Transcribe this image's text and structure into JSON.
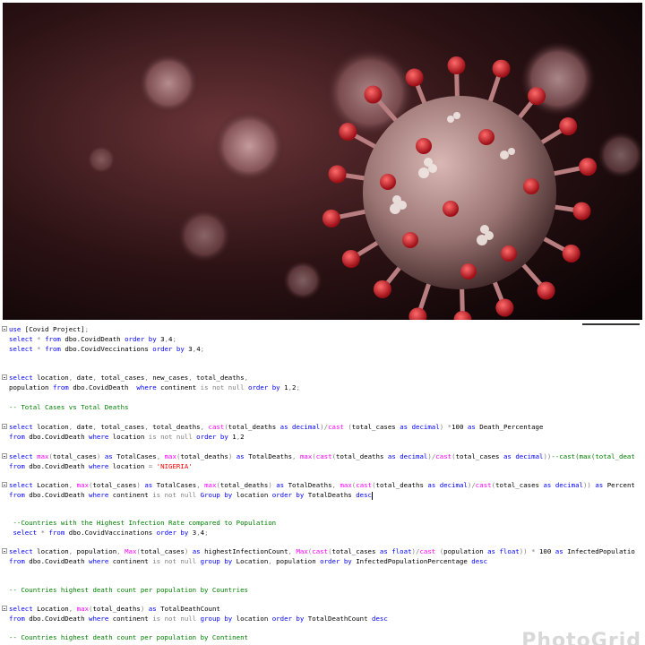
{
  "hero": {
    "description_icon": "virus-icon"
  },
  "editor": {
    "lines": [
      {
        "id": "l1",
        "fold": true,
        "parts": [
          [
            "kw",
            "use"
          ],
          [
            "id",
            " [Covid Project]"
          ],
          [
            "op",
            ";"
          ]
        ]
      },
      {
        "id": "l2",
        "fold": false,
        "parts": [
          [
            "kw",
            "select"
          ],
          [
            "op",
            " * "
          ],
          [
            "kw",
            "from"
          ],
          [
            "id",
            " dbo.CovidDeath "
          ],
          [
            "kw",
            "order by"
          ],
          [
            "id",
            " 3"
          ],
          [
            "op",
            ","
          ],
          [
            "id",
            "4"
          ],
          [
            "op",
            ";"
          ]
        ]
      },
      {
        "id": "l3",
        "fold": false,
        "parts": [
          [
            "kw",
            "select"
          ],
          [
            "op",
            " * "
          ],
          [
            "kw",
            "from"
          ],
          [
            "id",
            " dbo.CovidVeccinations "
          ],
          [
            "kw",
            "order by"
          ],
          [
            "id",
            " 3"
          ],
          [
            "op",
            ","
          ],
          [
            "id",
            "4"
          ],
          [
            "op",
            ";"
          ]
        ]
      },
      {
        "id": "l4",
        "fold": true,
        "parts": [
          [
            "kw",
            "select"
          ],
          [
            "id",
            " location"
          ],
          [
            "op",
            ","
          ],
          [
            "id",
            " date"
          ],
          [
            "op",
            ","
          ],
          [
            "id",
            " total_cases"
          ],
          [
            "op",
            ","
          ],
          [
            "id",
            " new_cases"
          ],
          [
            "op",
            ","
          ],
          [
            "id",
            " total_deaths"
          ],
          [
            "op",
            ","
          ]
        ]
      },
      {
        "id": "l5",
        "fold": false,
        "parts": [
          [
            "id",
            "population "
          ],
          [
            "kw",
            "from"
          ],
          [
            "id",
            " dbo.CovidDeath  "
          ],
          [
            "kw",
            "where"
          ],
          [
            "id",
            " continent "
          ],
          [
            "op",
            "is not null"
          ],
          [
            "id",
            " "
          ],
          [
            "kw",
            "order by"
          ],
          [
            "id",
            " 1"
          ],
          [
            "op",
            ","
          ],
          [
            "id",
            "2"
          ],
          [
            "op",
            ";"
          ]
        ]
      },
      {
        "id": "l6",
        "fold": false,
        "parts": [
          [
            "cm",
            "-- Total Cases vs Total Deaths"
          ]
        ]
      },
      {
        "id": "l7",
        "fold": true,
        "parts": [
          [
            "kw",
            "select"
          ],
          [
            "id",
            " location"
          ],
          [
            "op",
            ","
          ],
          [
            "id",
            " date"
          ],
          [
            "op",
            ","
          ],
          [
            "id",
            " total_cases"
          ],
          [
            "op",
            ","
          ],
          [
            "id",
            " total_deaths"
          ],
          [
            "op",
            ","
          ],
          [
            "id",
            " "
          ],
          [
            "fn",
            "cast"
          ],
          [
            "op",
            "("
          ],
          [
            "id",
            "total_deaths "
          ],
          [
            "kw",
            "as"
          ],
          [
            "id",
            " "
          ],
          [
            "kw",
            "decimal"
          ],
          [
            "op",
            ")/"
          ],
          [
            "fn",
            "cast"
          ],
          [
            "id",
            " "
          ],
          [
            "op",
            "("
          ],
          [
            "id",
            "total_cases "
          ],
          [
            "kw",
            "as"
          ],
          [
            "id",
            " "
          ],
          [
            "kw",
            "decimal"
          ],
          [
            "op",
            ")"
          ],
          [
            "id",
            " "
          ],
          [
            "op",
            "*"
          ],
          [
            "id",
            "100 "
          ],
          [
            "kw",
            "as"
          ],
          [
            "id",
            " Death_Percentage"
          ]
        ]
      },
      {
        "id": "l8",
        "fold": false,
        "parts": [
          [
            "kw",
            "from"
          ],
          [
            "id",
            " dbo.CovidDeath "
          ],
          [
            "kw",
            "where"
          ],
          [
            "id",
            " location "
          ],
          [
            "op",
            "is not null"
          ],
          [
            "id",
            " "
          ],
          [
            "kw",
            "order by"
          ],
          [
            "id",
            " 1"
          ],
          [
            "op",
            ","
          ],
          [
            "id",
            "2"
          ]
        ]
      },
      {
        "id": "l9",
        "fold": true,
        "parts": [
          [
            "kw",
            "select"
          ],
          [
            "id",
            " "
          ],
          [
            "fn",
            "max"
          ],
          [
            "op",
            "("
          ],
          [
            "id",
            "total_cases"
          ],
          [
            "op",
            ")"
          ],
          [
            "id",
            " "
          ],
          [
            "kw",
            "as"
          ],
          [
            "id",
            " TotalCases"
          ],
          [
            "op",
            ","
          ],
          [
            "id",
            " "
          ],
          [
            "fn",
            "max"
          ],
          [
            "op",
            "("
          ],
          [
            "id",
            "total_deaths"
          ],
          [
            "op",
            ")"
          ],
          [
            "id",
            " "
          ],
          [
            "kw",
            "as"
          ],
          [
            "id",
            " TotalDeaths"
          ],
          [
            "op",
            ","
          ],
          [
            "id",
            " "
          ],
          [
            "fn",
            "max"
          ],
          [
            "op",
            "("
          ],
          [
            "fn",
            "cast"
          ],
          [
            "op",
            "("
          ],
          [
            "id",
            "total_deaths "
          ],
          [
            "kw",
            "as"
          ],
          [
            "id",
            " "
          ],
          [
            "kw",
            "decimal"
          ],
          [
            "op",
            ")/"
          ],
          [
            "fn",
            "cast"
          ],
          [
            "op",
            "("
          ],
          [
            "id",
            "total_cases "
          ],
          [
            "kw",
            "as"
          ],
          [
            "id",
            " "
          ],
          [
            "kw",
            "decimal"
          ],
          [
            "op",
            "))"
          ],
          [
            "cm",
            "--cast(max(total_deat"
          ]
        ]
      },
      {
        "id": "l10",
        "fold": false,
        "parts": [
          [
            "kw",
            "from"
          ],
          [
            "id",
            " dbo.CovidDeath "
          ],
          [
            "kw",
            "where"
          ],
          [
            "id",
            " location "
          ],
          [
            "op",
            "="
          ],
          [
            "id",
            " "
          ],
          [
            "str",
            "'NIGERIA'"
          ]
        ]
      },
      {
        "id": "l11",
        "fold": true,
        "parts": [
          [
            "kw",
            "select"
          ],
          [
            "id",
            " Location"
          ],
          [
            "op",
            ","
          ],
          [
            "id",
            " "
          ],
          [
            "fn",
            "max"
          ],
          [
            "op",
            "("
          ],
          [
            "id",
            "total_cases"
          ],
          [
            "op",
            ")"
          ],
          [
            "id",
            " "
          ],
          [
            "kw",
            "as"
          ],
          [
            "id",
            " TotalCases"
          ],
          [
            "op",
            ","
          ],
          [
            "id",
            " "
          ],
          [
            "fn",
            "max"
          ],
          [
            "op",
            "("
          ],
          [
            "id",
            "total_deaths"
          ],
          [
            "op",
            ")"
          ],
          [
            "id",
            " "
          ],
          [
            "kw",
            "as"
          ],
          [
            "id",
            " TotalDeaths"
          ],
          [
            "op",
            ","
          ],
          [
            "id",
            " "
          ],
          [
            "fn",
            "max"
          ],
          [
            "op",
            "("
          ],
          [
            "fn",
            "cast"
          ],
          [
            "op",
            "("
          ],
          [
            "id",
            "total_deaths "
          ],
          [
            "kw",
            "as"
          ],
          [
            "id",
            " "
          ],
          [
            "kw",
            "decimal"
          ],
          [
            "op",
            ")/"
          ],
          [
            "fn",
            "cast"
          ],
          [
            "op",
            "("
          ],
          [
            "id",
            "total_cases "
          ],
          [
            "kw",
            "as"
          ],
          [
            "id",
            " "
          ],
          [
            "kw",
            "decimal"
          ],
          [
            "op",
            "))"
          ],
          [
            "id",
            " "
          ],
          [
            "kw",
            "as"
          ],
          [
            "id",
            " Percent"
          ]
        ]
      },
      {
        "id": "l12",
        "fold": false,
        "cursor": true,
        "parts": [
          [
            "kw",
            "from"
          ],
          [
            "id",
            " dbo.CovidDeath "
          ],
          [
            "kw",
            "where"
          ],
          [
            "id",
            " continent "
          ],
          [
            "op",
            "is not null"
          ],
          [
            "id",
            " "
          ],
          [
            "kw",
            "Group by"
          ],
          [
            "id",
            " location "
          ],
          [
            "kw",
            "order by"
          ],
          [
            "id",
            " TotalDeaths "
          ],
          [
            "kw",
            "desc"
          ]
        ]
      },
      {
        "id": "l13",
        "fold": false,
        "parts": [
          [
            "cm",
            " --Countries with the Highest Infection Rate compared to Population"
          ]
        ]
      },
      {
        "id": "l14",
        "fold": false,
        "parts": [
          [
            "id",
            " "
          ],
          [
            "kw",
            "select"
          ],
          [
            "op",
            " * "
          ],
          [
            "kw",
            "from"
          ],
          [
            "id",
            " dbo.CovidVaccinations "
          ],
          [
            "kw",
            "order by"
          ],
          [
            "id",
            " 3"
          ],
          [
            "op",
            ","
          ],
          [
            "id",
            "4"
          ],
          [
            "op",
            ";"
          ]
        ]
      },
      {
        "id": "l15",
        "fold": true,
        "parts": [
          [
            "kw",
            "select"
          ],
          [
            "id",
            " location"
          ],
          [
            "op",
            ","
          ],
          [
            "id",
            " population"
          ],
          [
            "op",
            ","
          ],
          [
            "id",
            " "
          ],
          [
            "fn",
            "Max"
          ],
          [
            "op",
            "("
          ],
          [
            "id",
            "total_cases"
          ],
          [
            "op",
            ")"
          ],
          [
            "id",
            " "
          ],
          [
            "kw",
            "as"
          ],
          [
            "id",
            " highestInfectionCount"
          ],
          [
            "op",
            ","
          ],
          [
            "id",
            " "
          ],
          [
            "fn",
            "Max"
          ],
          [
            "op",
            "("
          ],
          [
            "fn",
            "cast"
          ],
          [
            "op",
            "("
          ],
          [
            "id",
            "total_cases "
          ],
          [
            "kw",
            "as"
          ],
          [
            "id",
            " "
          ],
          [
            "kw",
            "float"
          ],
          [
            "op",
            ")/"
          ],
          [
            "fn",
            "cast"
          ],
          [
            "id",
            " "
          ],
          [
            "op",
            "("
          ],
          [
            "id",
            "population "
          ],
          [
            "kw",
            "as"
          ],
          [
            "id",
            " "
          ],
          [
            "kw",
            "float"
          ],
          [
            "op",
            "))"
          ],
          [
            "id",
            " "
          ],
          [
            "op",
            "*"
          ],
          [
            "id",
            " 100 "
          ],
          [
            "kw",
            "as"
          ],
          [
            "id",
            " InfectedPopulatio"
          ]
        ]
      },
      {
        "id": "l16",
        "fold": false,
        "parts": [
          [
            "kw",
            "from"
          ],
          [
            "id",
            " dbo.CovidDeath "
          ],
          [
            "kw",
            "where"
          ],
          [
            "id",
            " continent "
          ],
          [
            "op",
            "is not null"
          ],
          [
            "id",
            " "
          ],
          [
            "kw",
            "group by"
          ],
          [
            "id",
            " Location"
          ],
          [
            "op",
            ","
          ],
          [
            "id",
            " population "
          ],
          [
            "kw",
            "order by"
          ],
          [
            "id",
            " InfectedPopulationPercentage "
          ],
          [
            "kw",
            "desc"
          ]
        ]
      },
      {
        "id": "l17",
        "fold": false,
        "parts": [
          [
            "cm",
            "-- Countries highest death count per population by Countries"
          ]
        ]
      },
      {
        "id": "l18",
        "fold": true,
        "parts": [
          [
            "kw",
            "select"
          ],
          [
            "id",
            " Location"
          ],
          [
            "op",
            ","
          ],
          [
            "id",
            " "
          ],
          [
            "fn",
            "max"
          ],
          [
            "op",
            "("
          ],
          [
            "id",
            "total_deaths"
          ],
          [
            "op",
            ")"
          ],
          [
            "id",
            " "
          ],
          [
            "kw",
            "as"
          ],
          [
            "id",
            " TotalDeathCount"
          ]
        ]
      },
      {
        "id": "l19",
        "fold": false,
        "parts": [
          [
            "kw",
            "from"
          ],
          [
            "id",
            " dbo.CovidDeath "
          ],
          [
            "kw",
            "where"
          ],
          [
            "id",
            " continent "
          ],
          [
            "op",
            "is not null"
          ],
          [
            "id",
            " "
          ],
          [
            "kw",
            "group by"
          ],
          [
            "id",
            " location "
          ],
          [
            "kw",
            "order by"
          ],
          [
            "id",
            " TotalDeathCount "
          ],
          [
            "kw",
            "desc"
          ]
        ]
      },
      {
        "id": "l20",
        "fold": false,
        "parts": [
          [
            "cm",
            "-- Countries highest death count per population by Continent"
          ]
        ]
      }
    ]
  },
  "watermark": "PhotoGrid",
  "colors": {
    "keyword": "#0000ff",
    "function": "#ff00ff",
    "operator": "#808080",
    "string": "#ff0000",
    "comment": "#008000"
  }
}
